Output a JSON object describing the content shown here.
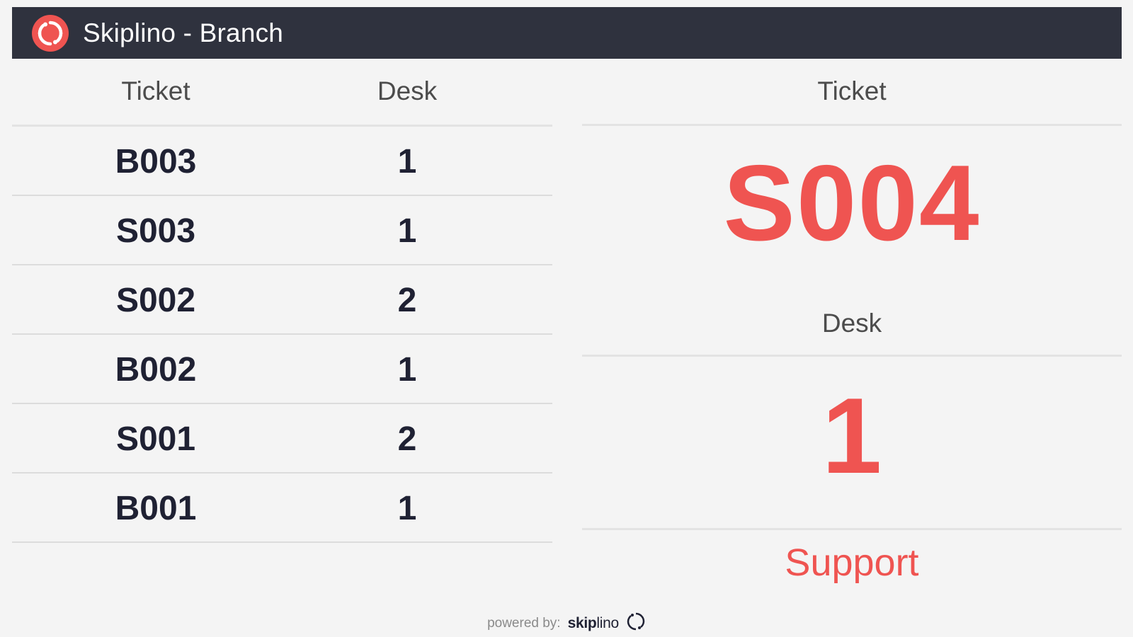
{
  "header": {
    "title": "Skiplino - Branch",
    "logo_icon": "skiplino-logo-icon",
    "background_color": "#2f323e"
  },
  "queue": {
    "columns": {
      "ticket": "Ticket",
      "desk": "Desk"
    },
    "rows": [
      {
        "ticket": "B003",
        "desk": "1"
      },
      {
        "ticket": "S003",
        "desk": "1"
      },
      {
        "ticket": "S002",
        "desk": "2"
      },
      {
        "ticket": "B002",
        "desk": "1"
      },
      {
        "ticket": "S001",
        "desk": "2"
      },
      {
        "ticket": "B001",
        "desk": "1"
      }
    ]
  },
  "current": {
    "ticket_label": "Ticket",
    "ticket": "S004",
    "desk_label": "Desk",
    "desk": "1",
    "service": "Support",
    "accent_color": "#ef5451"
  },
  "footer": {
    "powered_by": "powered by:",
    "brand_bold": "skip",
    "brand_light": "lino",
    "brand_icon": "skiplino-ring-icon"
  }
}
